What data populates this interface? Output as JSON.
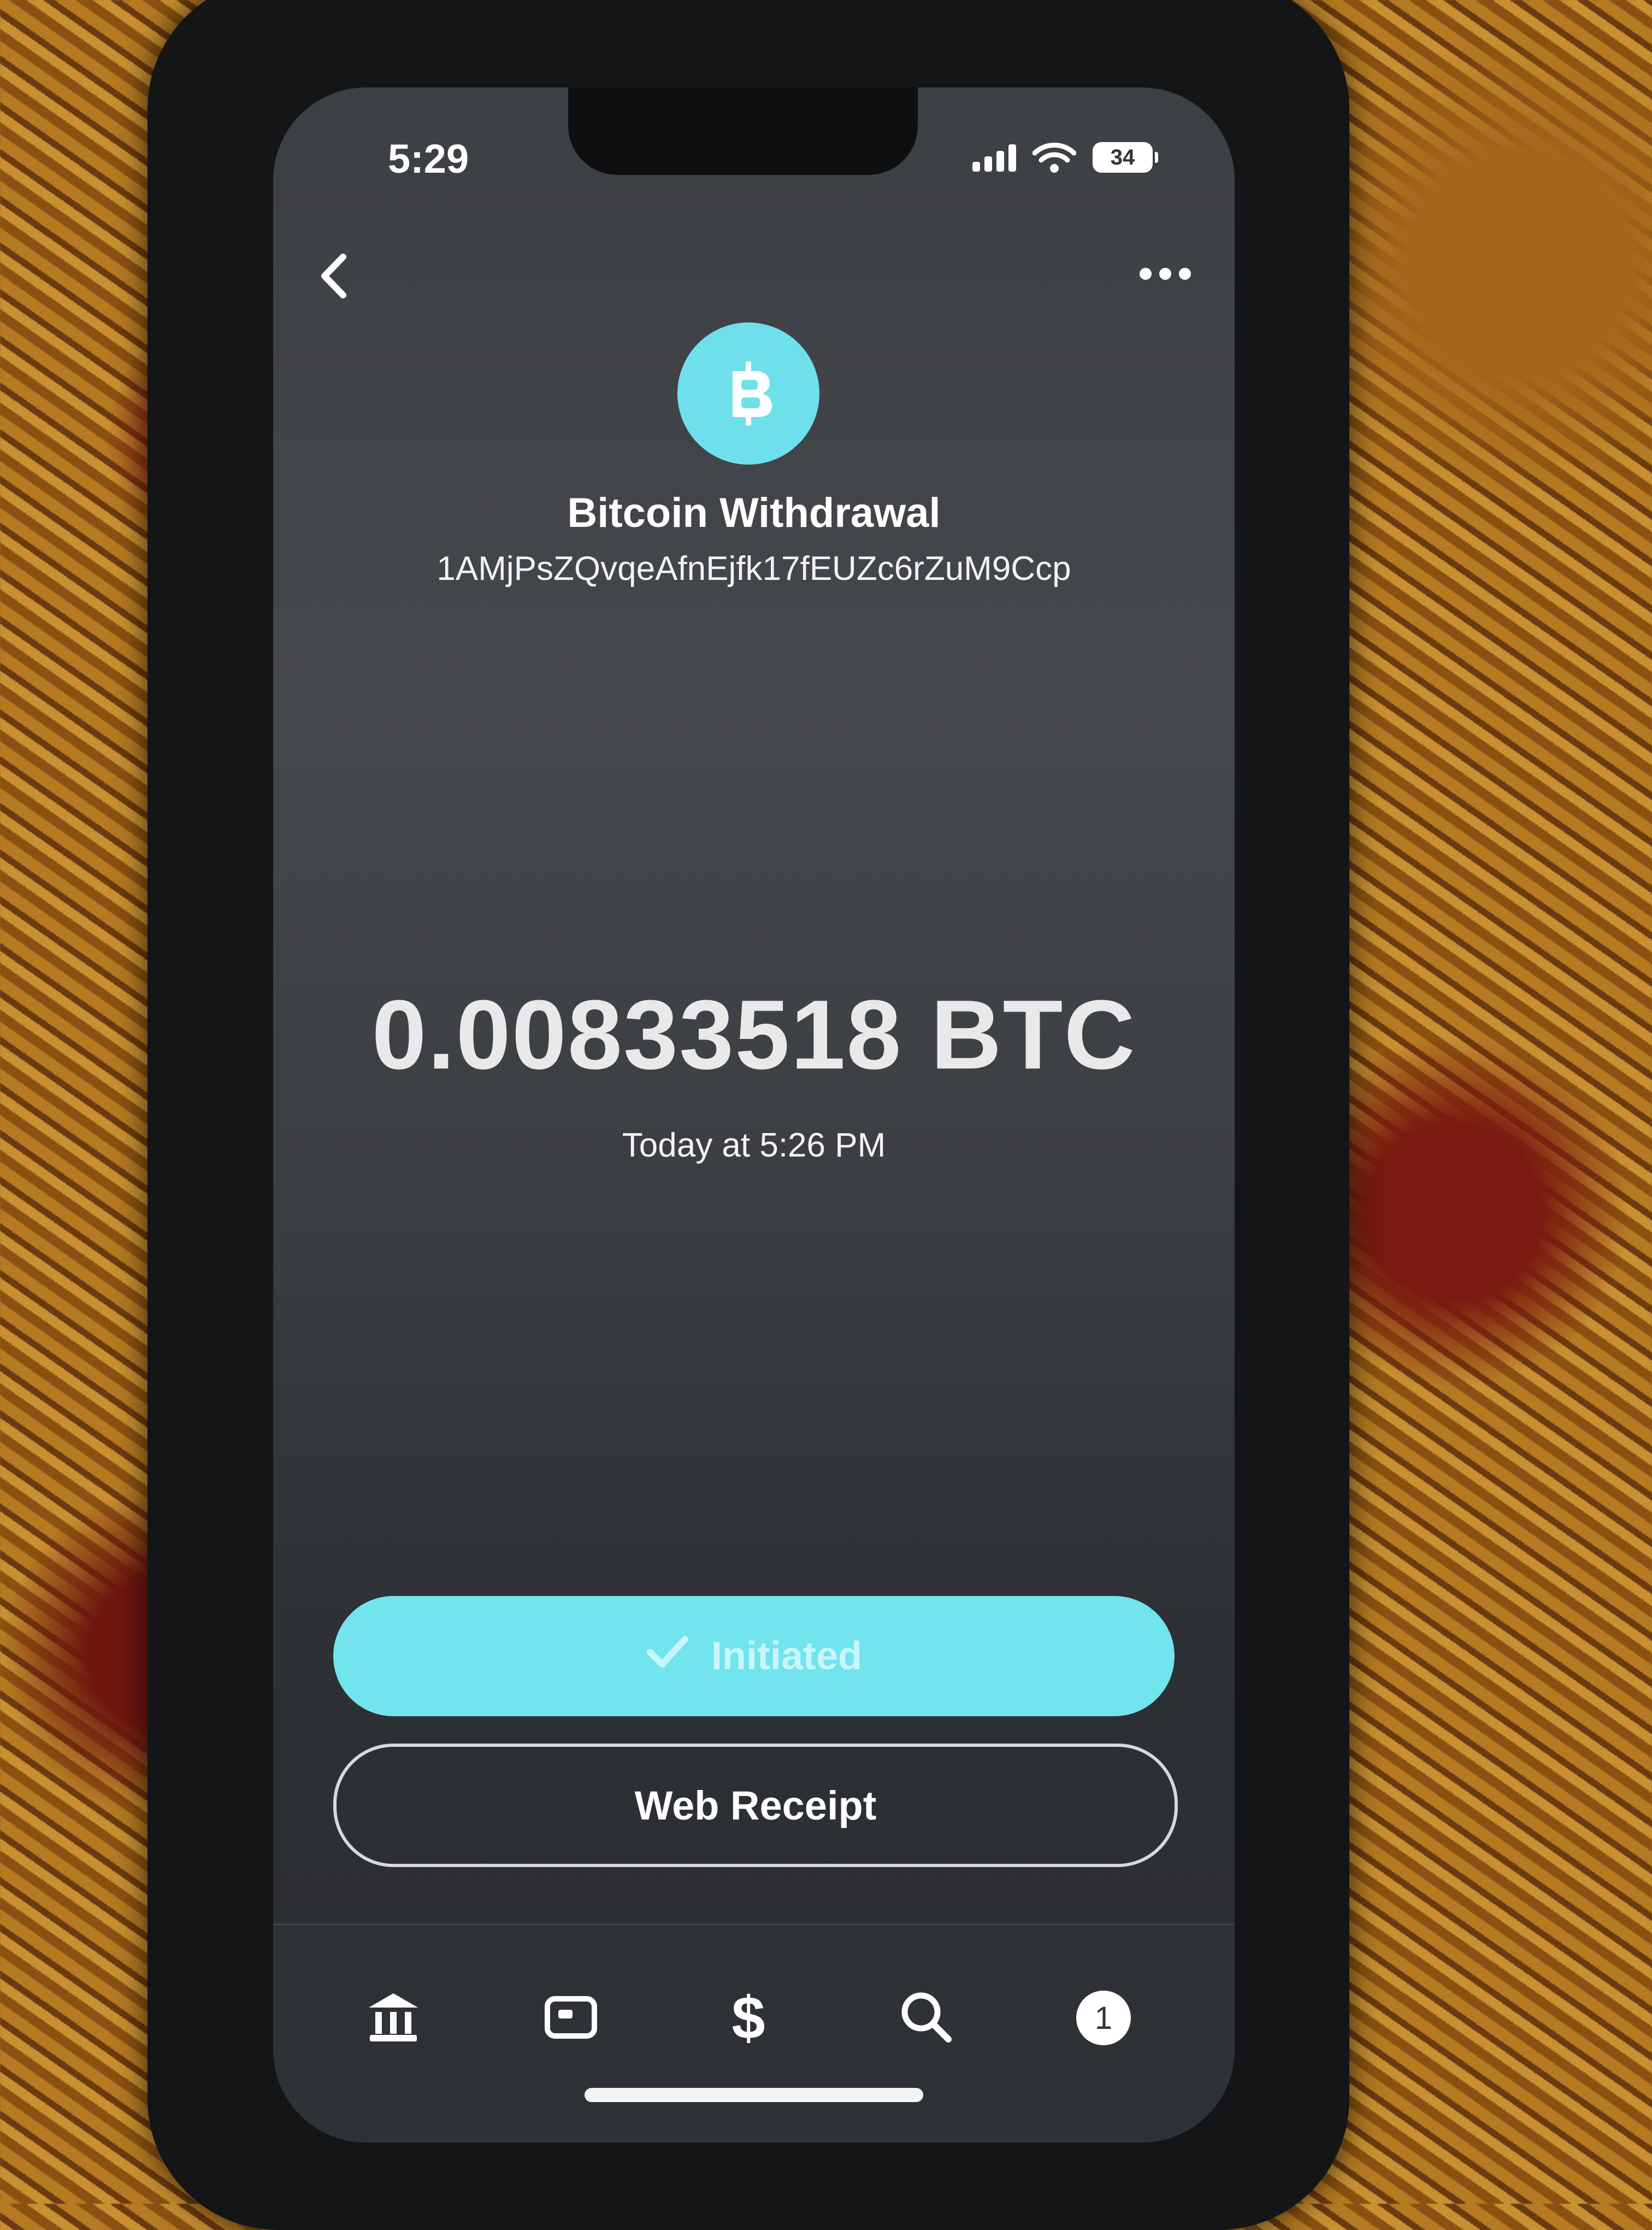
{
  "status_bar": {
    "time": "5:29",
    "battery": "34",
    "icons": [
      "signal-icon",
      "wifi-icon",
      "battery-icon"
    ]
  },
  "nav": {
    "back_icon": "chevron-left-icon",
    "more_icon": "more-horizontal-icon"
  },
  "transaction": {
    "icon": "bitcoin-icon",
    "title": "Bitcoin Withdrawal",
    "address": "1AMjPsZQvqeAfnEjfk17fEUZc6rZuM9Ccp",
    "amount": "0.00833518 BTC",
    "timestamp": "Today at 5:26 PM"
  },
  "actions": {
    "status_label": "Initiated",
    "status_icon": "checkmark-icon",
    "receipt_label": "Web Receipt"
  },
  "tab_bar": {
    "items": [
      {
        "name": "home",
        "icon": "bank-icon"
      },
      {
        "name": "card",
        "icon": "card-icon"
      },
      {
        "name": "money",
        "icon": "dollar-icon",
        "glyph": "$"
      },
      {
        "name": "search",
        "icon": "search-icon"
      },
      {
        "name": "activity",
        "icon": "activity-badge-icon",
        "badge": "1"
      }
    ]
  },
  "colors": {
    "accent": "#71e4ee",
    "background": "#3c3f43",
    "text": "#ffffff"
  }
}
